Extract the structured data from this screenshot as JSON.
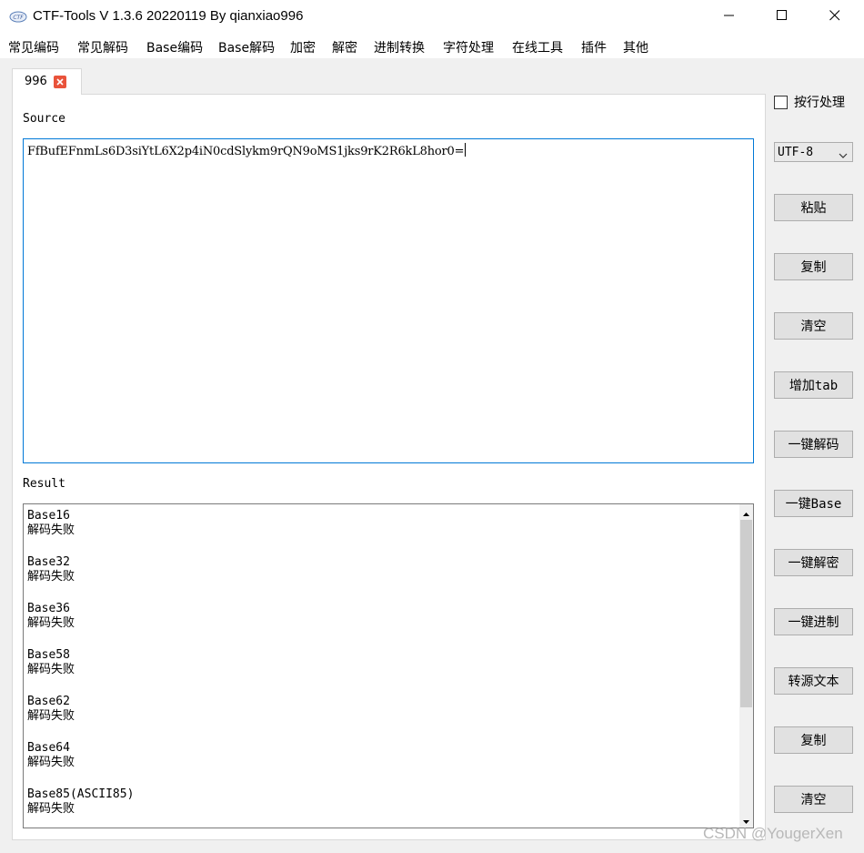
{
  "window": {
    "title": "CTF-Tools V 1.3.6 20220119 By qianxiao996",
    "icon": "ctf-app-icon"
  },
  "menu": [
    {
      "label": "常见编码"
    },
    {
      "label": "常见解码"
    },
    {
      "label": "Base编码"
    },
    {
      "label": "Base解码"
    },
    {
      "label": "加密"
    },
    {
      "label": "解密"
    },
    {
      "label": "进制转换"
    },
    {
      "label": "字符处理"
    },
    {
      "label": "在线工具"
    },
    {
      "label": "插件"
    },
    {
      "label": "其他"
    }
  ],
  "tabs": [
    {
      "label": "996",
      "active": true
    }
  ],
  "source": {
    "label": "Source",
    "value": "FfBufEFnmLs6D3siYtL6X2p4iN0cdSlykm9rQN9oMS1jks9rK2R6kL8hor0="
  },
  "result": {
    "label": "Result",
    "entries": [
      {
        "name": "Base16",
        "status": "解码失败"
      },
      {
        "name": "Base32",
        "status": "解码失败"
      },
      {
        "name": "Base36",
        "status": "解码失败"
      },
      {
        "name": "Base58",
        "status": "解码失败"
      },
      {
        "name": "Base62",
        "status": "解码失败"
      },
      {
        "name": "Base64",
        "status": "解码失败"
      },
      {
        "name": "Base85(ASCII85)",
        "status": "解码失败"
      }
    ]
  },
  "sidebar": {
    "checkbox_label": "按行处理",
    "checkbox_checked": false,
    "encoding": "UTF-8",
    "buttons": [
      {
        "label": "粘贴"
      },
      {
        "label": "复制"
      },
      {
        "label": "清空"
      },
      {
        "label": "增加tab"
      },
      {
        "label": "一键解码"
      },
      {
        "label": "一键Base"
      },
      {
        "label": "一键解密"
      },
      {
        "label": "一键进制"
      },
      {
        "label": "转源文本"
      },
      {
        "label": "复制"
      },
      {
        "label": "清空"
      }
    ]
  },
  "watermark": "CSDN @YougerXen",
  "colors": {
    "accent_border": "#0078d7",
    "tab_close": "#e9533b",
    "client_bg": "#f0f0f0",
    "button_bg": "#e1e1e1"
  }
}
